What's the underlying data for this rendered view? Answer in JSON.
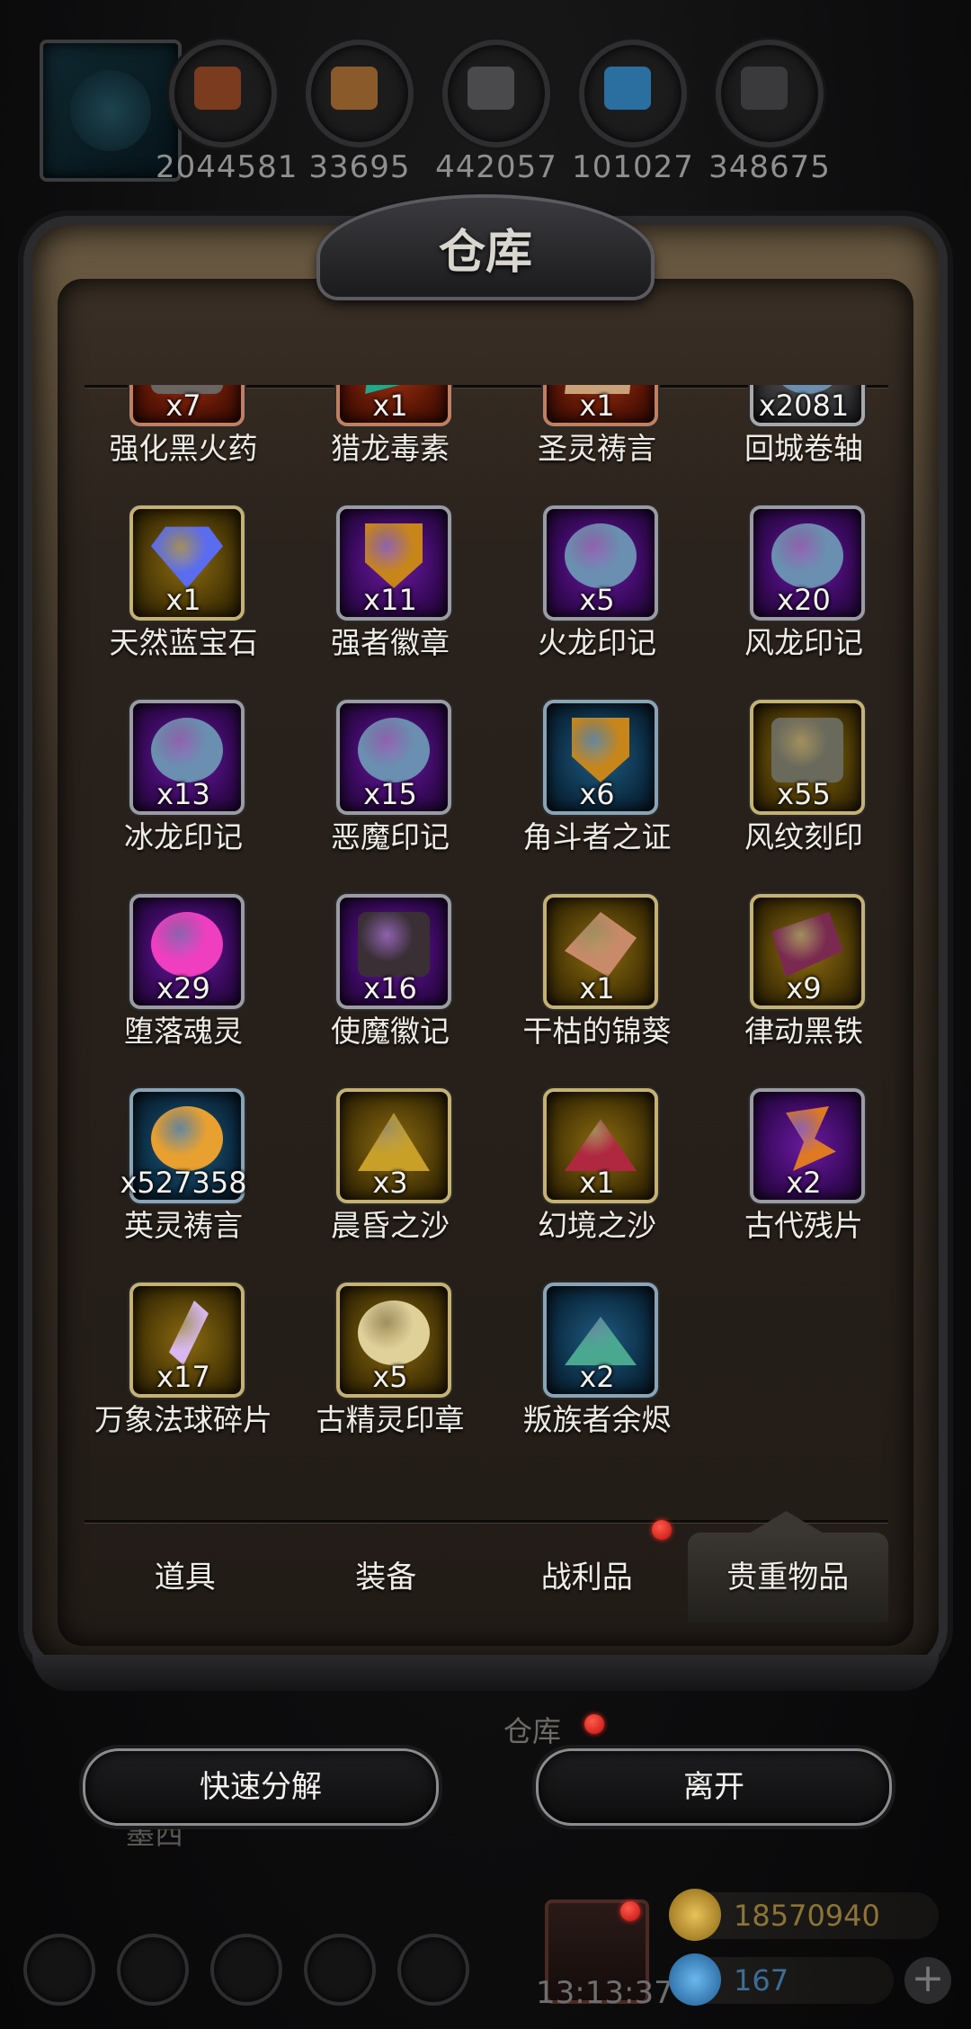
{
  "resources": [
    {
      "icon": "meat-icon",
      "value": "2044581",
      "color": "#7b3b1e"
    },
    {
      "icon": "wood-icon",
      "value": "33695",
      "color": "#8b5a2b"
    },
    {
      "icon": "stone-icon",
      "value": "442057",
      "color": "#4a4a4c"
    },
    {
      "icon": "crystal-icon",
      "value": "101027",
      "color": "#2b6ea0"
    },
    {
      "icon": "iron-icon",
      "value": "348675",
      "color": "#3a3a3c"
    }
  ],
  "panel": {
    "title": "仓库"
  },
  "items": [
    {
      "name": "强化黑火药",
      "count": "x7",
      "rarity": "red",
      "icon": "powder-icon"
    },
    {
      "name": "猎龙毒素",
      "count": "x1",
      "rarity": "red",
      "icon": "toxin-icon"
    },
    {
      "name": "圣灵祷言",
      "count": "x1",
      "rarity": "red",
      "icon": "scroll-icon"
    },
    {
      "name": "回城卷轴",
      "count": "x2081",
      "rarity": "grey",
      "icon": "swirl-icon"
    },
    {
      "name": "天然蓝宝石",
      "count": "x1",
      "rarity": "gold",
      "icon": "sapphire-icon"
    },
    {
      "name": "强者徽章",
      "count": "x11",
      "rarity": "purple",
      "icon": "shield-badge-icon"
    },
    {
      "name": "火龙印记",
      "count": "x5",
      "rarity": "purple",
      "icon": "swirl-icon"
    },
    {
      "name": "风龙印记",
      "count": "x20",
      "rarity": "purple",
      "icon": "swirl-icon"
    },
    {
      "name": "冰龙印记",
      "count": "x13",
      "rarity": "purple",
      "icon": "swirl-icon"
    },
    {
      "name": "恶魔印记",
      "count": "x15",
      "rarity": "purple",
      "icon": "swirl-icon"
    },
    {
      "name": "角斗者之证",
      "count": "x6",
      "rarity": "blue",
      "icon": "shield-badge-icon"
    },
    {
      "name": "风纹刻印",
      "count": "x55",
      "rarity": "gold",
      "icon": "rune-plate-icon"
    },
    {
      "name": "堕落魂灵",
      "count": "x29",
      "rarity": "purple",
      "icon": "soul-orb-icon"
    },
    {
      "name": "使魔徽记",
      "count": "x16",
      "rarity": "purple",
      "icon": "dark-emblem-icon"
    },
    {
      "name": "干枯的锦葵",
      "count": "x1",
      "rarity": "gold",
      "icon": "leaf-icon"
    },
    {
      "name": "律动黑铁",
      "count": "x9",
      "rarity": "gold",
      "icon": "black-iron-icon"
    },
    {
      "name": "英灵祷言",
      "count": "x527358",
      "rarity": "blue",
      "icon": "golden-orb-icon"
    },
    {
      "name": "晨昏之沙",
      "count": "x3",
      "rarity": "gold",
      "icon": "sand-pile-icon"
    },
    {
      "name": "幻境之沙",
      "count": "x1",
      "rarity": "gold",
      "icon": "red-sand-icon"
    },
    {
      "name": "古代残片",
      "count": "x2",
      "rarity": "purple",
      "icon": "fragment-icon"
    },
    {
      "name": "万象法球碎片",
      "count": "x17",
      "rarity": "gold",
      "icon": "crystal-shard-icon"
    },
    {
      "name": "古精灵印章",
      "count": "x5",
      "rarity": "gold",
      "icon": "elf-seal-icon"
    },
    {
      "name": "叛族者余烬",
      "count": "x2",
      "rarity": "blue",
      "icon": "ember-icon"
    }
  ],
  "tabs": [
    {
      "label": "道具",
      "active": false,
      "dot": false
    },
    {
      "label": "装备",
      "active": false,
      "dot": false
    },
    {
      "label": "战利品",
      "active": false,
      "dot": true
    },
    {
      "label": "贵重物品",
      "active": true,
      "dot": false
    }
  ],
  "under_label": "仓库",
  "under_label2": "墨西",
  "buttons": {
    "quick_decompose": "快速分解",
    "leave": "离开"
  },
  "hud": {
    "time": "13:13:37",
    "gold": "18570940",
    "gems": "167"
  },
  "colors": {
    "accent_gold": "#c5a14a",
    "notification_red": "#e02a1a",
    "gem_blue": "#3a86c8"
  }
}
